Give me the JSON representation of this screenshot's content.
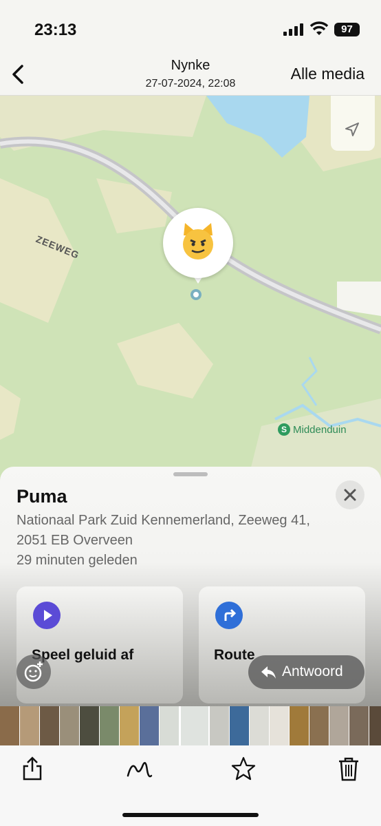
{
  "status": {
    "time": "23:13",
    "battery": "97",
    "icons": [
      "signal-icon",
      "wifi-icon",
      "battery-icon"
    ]
  },
  "nav": {
    "title": "Nynke",
    "subtitle": "27-07-2024, 22:08",
    "right_label": "Alle media",
    "back_icon": "chevron-left-icon"
  },
  "map": {
    "road_label": "ZEEWEG",
    "poi_label": "Middenduin",
    "pin_icon": "grinning-cat-emoji-icon",
    "colors": {
      "land": "#cfe3b7",
      "light_land": "#e8e7c6",
      "water": "#a9d8ef",
      "road": "#cfcfd2",
      "poi": "#2e9b5f"
    }
  },
  "sheet": {
    "name": "Puma",
    "address_line1": "Nationaal Park Zuid Kennemerland, Zeeweg 41,",
    "address_line2": "2051 EB Overveen",
    "time_ago": "29 minuten geleden",
    "actions": [
      {
        "label": "Speel geluid af",
        "icon": "play-icon",
        "color": "#5b4bd6"
      },
      {
        "label": "Route",
        "icon": "route-arrow-icon",
        "color": "#2f6fd8"
      }
    ],
    "reply_label": "Antwoord",
    "reply_icon": "reply-arrow-icon",
    "emoji_icon": "add-emoji-icon"
  },
  "thumbnails": [
    "#8a6b4a",
    "#b59a78",
    "#6d5a45",
    "#9a8f7a",
    "#4d4d3f",
    "#7a8a6a",
    "#c4a25a",
    "#5a6f9a",
    "#d8dcd6",
    "#dfe3df",
    "#c8c8c2",
    "#3d6a9a",
    "#dcdcd6",
    "#e6e2da",
    "#a07a3a",
    "#8a7050",
    "#b0a69a",
    "#7a6a5a",
    "#5a4a3a",
    "#8a8070"
  ],
  "toolbar": [
    "share-icon",
    "markup-icon",
    "favorite-star-icon",
    "trash-icon"
  ]
}
